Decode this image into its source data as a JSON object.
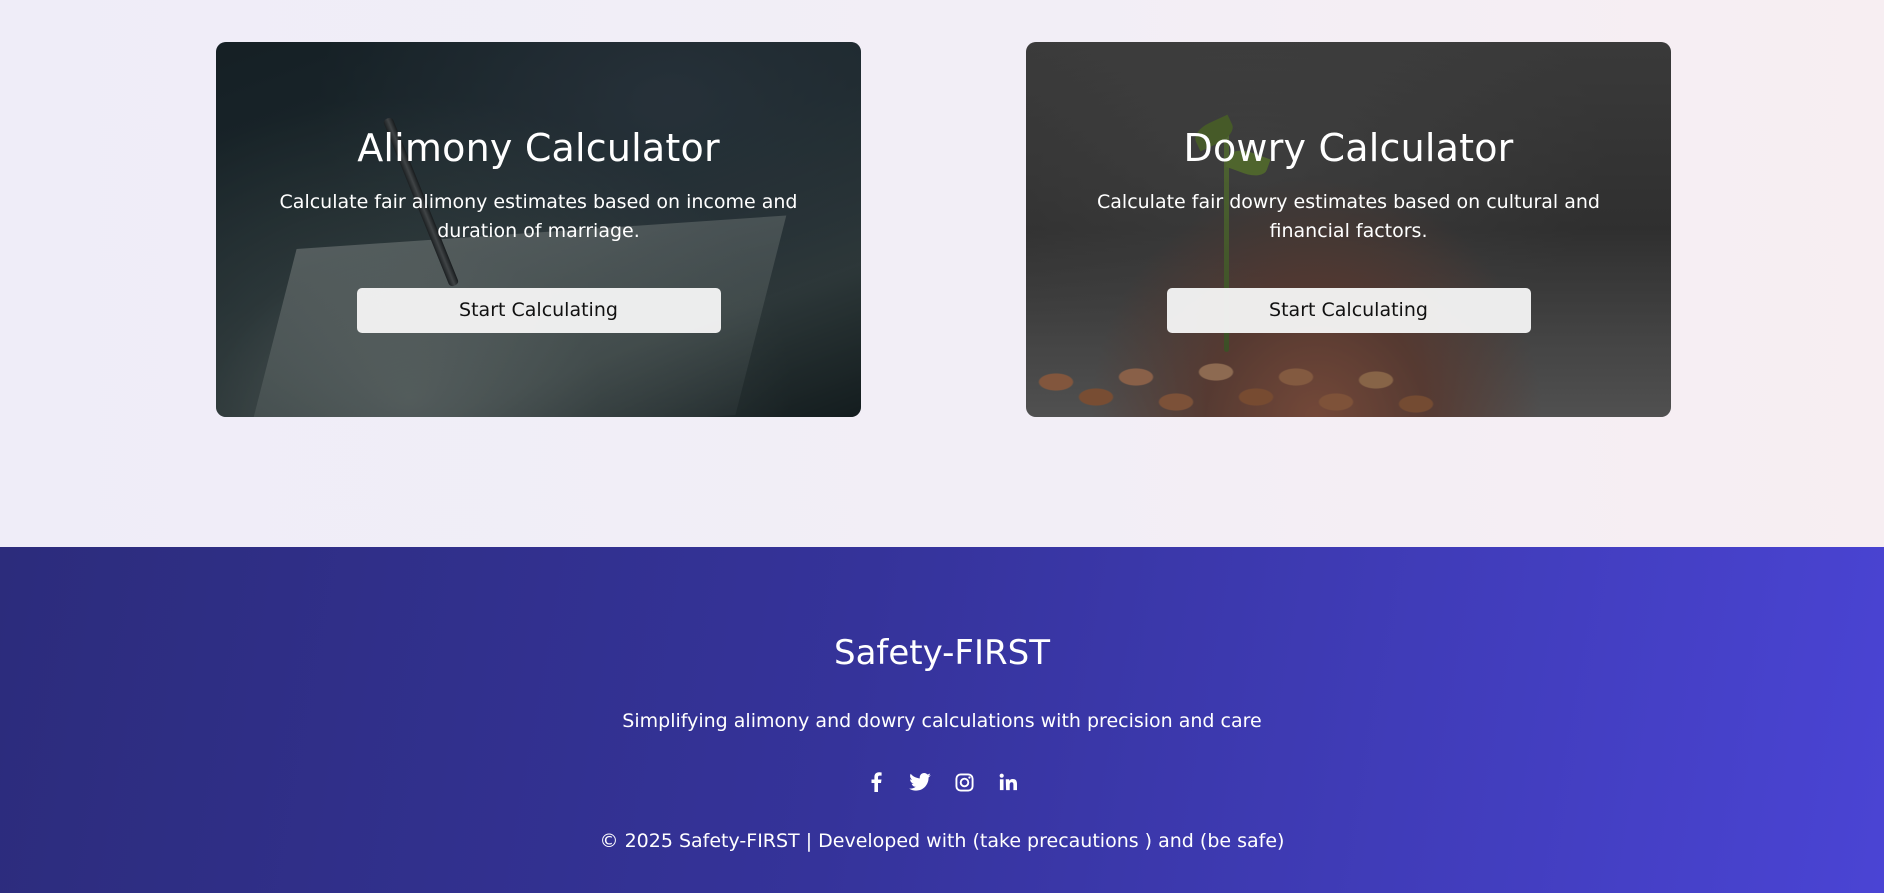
{
  "cards": [
    {
      "title": "Alimony Calculator",
      "description": "Calculate fair alimony estimates based on income and duration of marriage.",
      "button_label": "Start Calculating"
    },
    {
      "title": "Dowry Calculator",
      "description": "Calculate fair dowry estimates based on cultural and financial factors.",
      "button_label": "Start Calculating"
    }
  ],
  "footer": {
    "brand": "Safety-FIRST",
    "tagline": "Simplifying alimony and dowry calculations with precision and care",
    "social": [
      "facebook-icon",
      "twitter-icon",
      "instagram-icon",
      "linkedin-icon"
    ],
    "copyright": "© 2025 Safety-FIRST | Developed with (take precautions ) and (be safe)"
  },
  "colors": {
    "footer_gradient_start": "#2c2c7c",
    "footer_gradient_end": "#4a44d4",
    "button_bg": "#f5f5f5",
    "page_bg": "#f0eef7"
  }
}
